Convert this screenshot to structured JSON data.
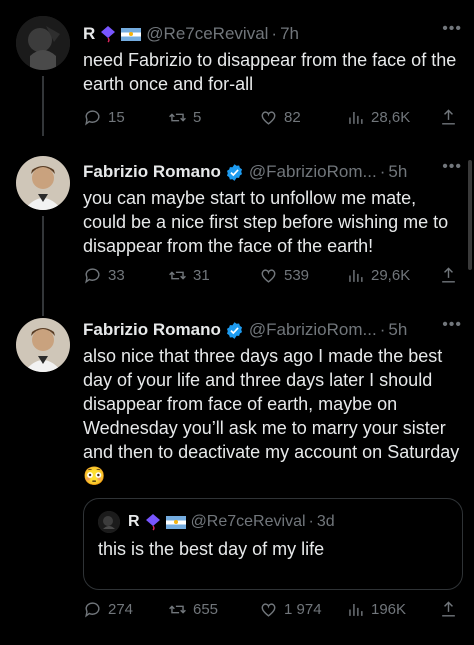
{
  "tweets": [
    {
      "name": "R",
      "handle": "@Re7ceRevival",
      "time": "7h",
      "text": "need Fabrizio to disappear from the face of the earth once and for-all",
      "replies": "15",
      "reposts": "5",
      "likes": "82",
      "views": "28,6K"
    },
    {
      "name": "Fabrizio Romano",
      "handle": "@FabrizioRom...",
      "time": "5h",
      "text": "you can maybe start to unfollow me mate, could be a nice first step before wishing me to disappear from the face of the earth!",
      "replies": "33",
      "reposts": "31",
      "likes": "539",
      "views": "29,6K"
    },
    {
      "name": "Fabrizio Romano",
      "handle": "@FabrizioRom...",
      "time": "5h",
      "text": "also nice that three days ago I made the best day of your life and three days later I should disappear from face of earth, maybe on Wednesday you’ll ask me to marry your sister and then to deactivate my account on Saturday 😳",
      "replies": "274",
      "reposts": "655",
      "likes": "1 974",
      "views": "196K",
      "quote": {
        "name": "R",
        "handle": "@Re7ceRevival",
        "time": "3d",
        "text": "this is the best day of my life"
      }
    }
  ],
  "icons": {
    "reply": "speech-bubble-icon",
    "repost": "repost-arrows-icon",
    "like": "heart-icon",
    "views": "bar-chart-icon",
    "share": "share-upload-icon",
    "more": "more-dots-icon",
    "verified": "verified-badge-icon"
  },
  "colors": {
    "background": "#000000",
    "text": "#e7e9ea",
    "muted": "#71767b",
    "verified": "#1d9bf0",
    "border": "#2f3336"
  }
}
